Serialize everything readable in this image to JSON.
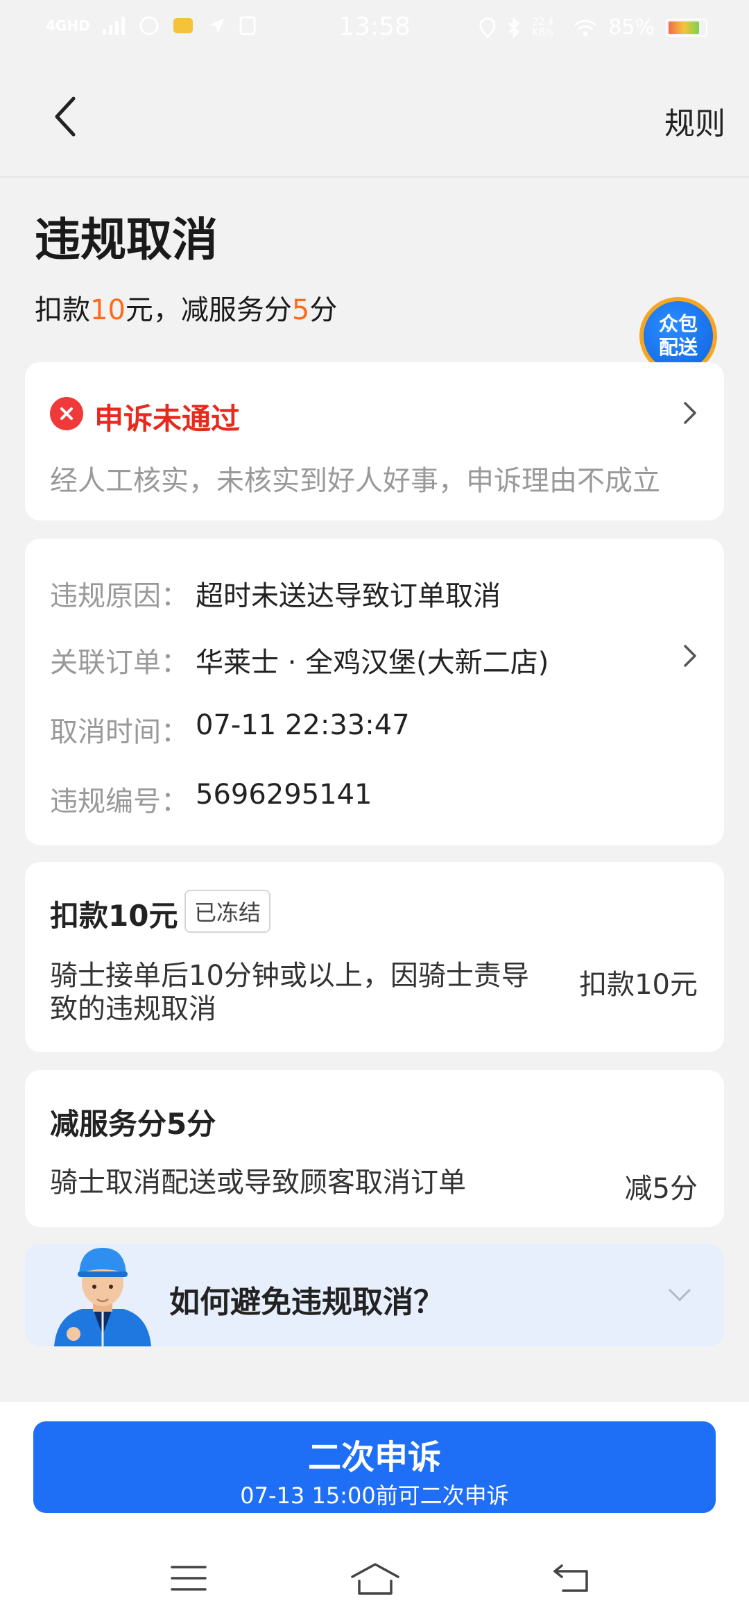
{
  "status_bar": {
    "network": "4GHD",
    "time": "13:58",
    "speed": "22.4 KB/s",
    "battery": "85%",
    "battery_level": 0.85
  },
  "nav": {
    "rules_label": "规则"
  },
  "header": {
    "title": "违规取消",
    "subtitle": {
      "p1": "扣款",
      "v1": "10",
      "p2": "元，减服务分",
      "v2": "5",
      "p3": "分"
    },
    "badge_line1": "众包",
    "badge_line2": "配送"
  },
  "appeal_status": {
    "title": "申诉未通过",
    "desc": "经人工核实，未核实到好人好事，申诉理由不成立"
  },
  "violation_info": [
    {
      "label": "违规原因：",
      "value": "超时未送达导致订单取消"
    },
    {
      "label": "关联订单：",
      "value": "华莱士 · 全鸡汉堡(大新二店)"
    },
    {
      "label": "取消时间：",
      "value": "07-11 22:33:47"
    },
    {
      "label": "违规编号：",
      "value": "5696295141"
    }
  ],
  "deduction": {
    "title": "扣款10元",
    "tag": "已冻结",
    "rule_line1": "骑士接单后10分钟或以上，因骑士责导",
    "rule_line2": "致的违规取消",
    "amount": "扣款10元"
  },
  "service_score": {
    "title": "减服务分5分",
    "rule": "骑士取消配送或导致顾客取消订单",
    "amount": "减5分"
  },
  "tip": {
    "title": "如何避免违规取消？"
  },
  "action": {
    "button": "二次申诉",
    "deadline": "07-13 15:00前可二次申诉"
  },
  "colors": {
    "primary": "#1e6ff5",
    "highlight": "#ff6a1a",
    "error": "#e8291e",
    "background": "#f2f2f2"
  }
}
